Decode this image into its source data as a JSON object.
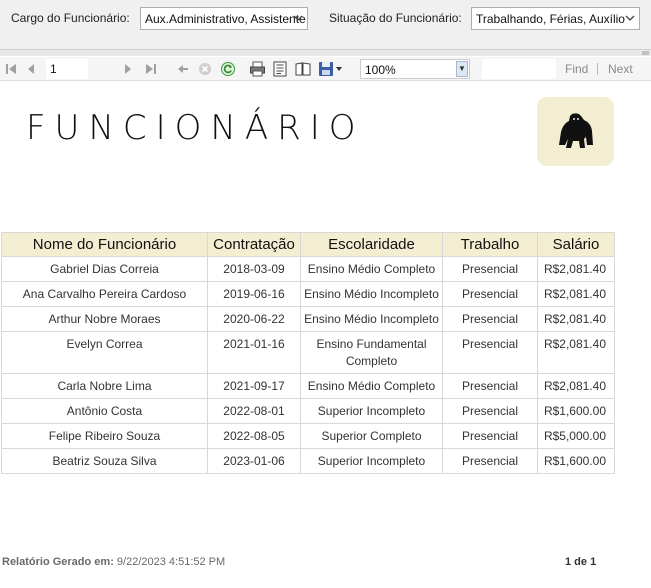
{
  "params": {
    "cargo_label": "Cargo do Funcionário:",
    "cargo_value": "Aux.Administrativo, Assistente",
    "situacao_label": "Situação do Funcionário:",
    "situacao_value": "Trabalhando, Férias, Auxílio"
  },
  "toolbar": {
    "page_number": "1",
    "zoom": "100%",
    "find_label": "Find",
    "next_label": "Next",
    "icons": [
      "first-page-icon",
      "previous-page-icon",
      "next-page-icon",
      "last-page-icon",
      "back-icon",
      "stop-icon",
      "refresh-icon",
      "print-icon",
      "print-layout-icon",
      "page-setup-icon",
      "export-icon"
    ]
  },
  "report": {
    "title": "FUNCIONÁRIO",
    "logo_icon": "gorilla-icon",
    "header_color": "#f3edd2",
    "columns": [
      "Nome do Funcionário",
      "Contratação",
      "Escolaridade",
      "Trabalho",
      "Salário"
    ],
    "rows": [
      [
        "Gabriel Dias Correia",
        "2018-03-09",
        "Ensino Médio Completo",
        "Presencial",
        "R$2,081.40"
      ],
      [
        "Ana Carvalho Pereira Cardoso",
        "2019-06-16",
        "Ensino Médio Incompleto",
        "Presencial",
        "R$2,081.40"
      ],
      [
        "Arthur Nobre Moraes",
        "2020-06-22",
        "Ensino Médio Incompleto",
        "Presencial",
        "R$2,081.40"
      ],
      [
        "Evelyn Correa",
        "2021-01-16",
        "Ensino Fundamental Completo",
        "Presencial",
        "R$2,081.40"
      ],
      [
        "Carla Nobre Lima",
        "2021-09-17",
        "Ensino Médio Completo",
        "Presencial",
        "R$2,081.40"
      ],
      [
        "Antônio Costa",
        "2022-08-01",
        "Superior Incompleto",
        "Presencial",
        "R$1,600.00"
      ],
      [
        "Felipe Ribeiro Souza",
        "2022-08-05",
        "Superior Completo",
        "Presencial",
        "R$5,000.00"
      ],
      [
        "Beatriz Souza Silva",
        "2023-01-06",
        "Superior Incompleto",
        "Presencial",
        "R$1,600.00"
      ]
    ]
  },
  "footer": {
    "generated_label": "Relatório Gerado em:",
    "generated_value": "9/22/2023 4:51:52 PM",
    "page_info": "1 de 1"
  }
}
